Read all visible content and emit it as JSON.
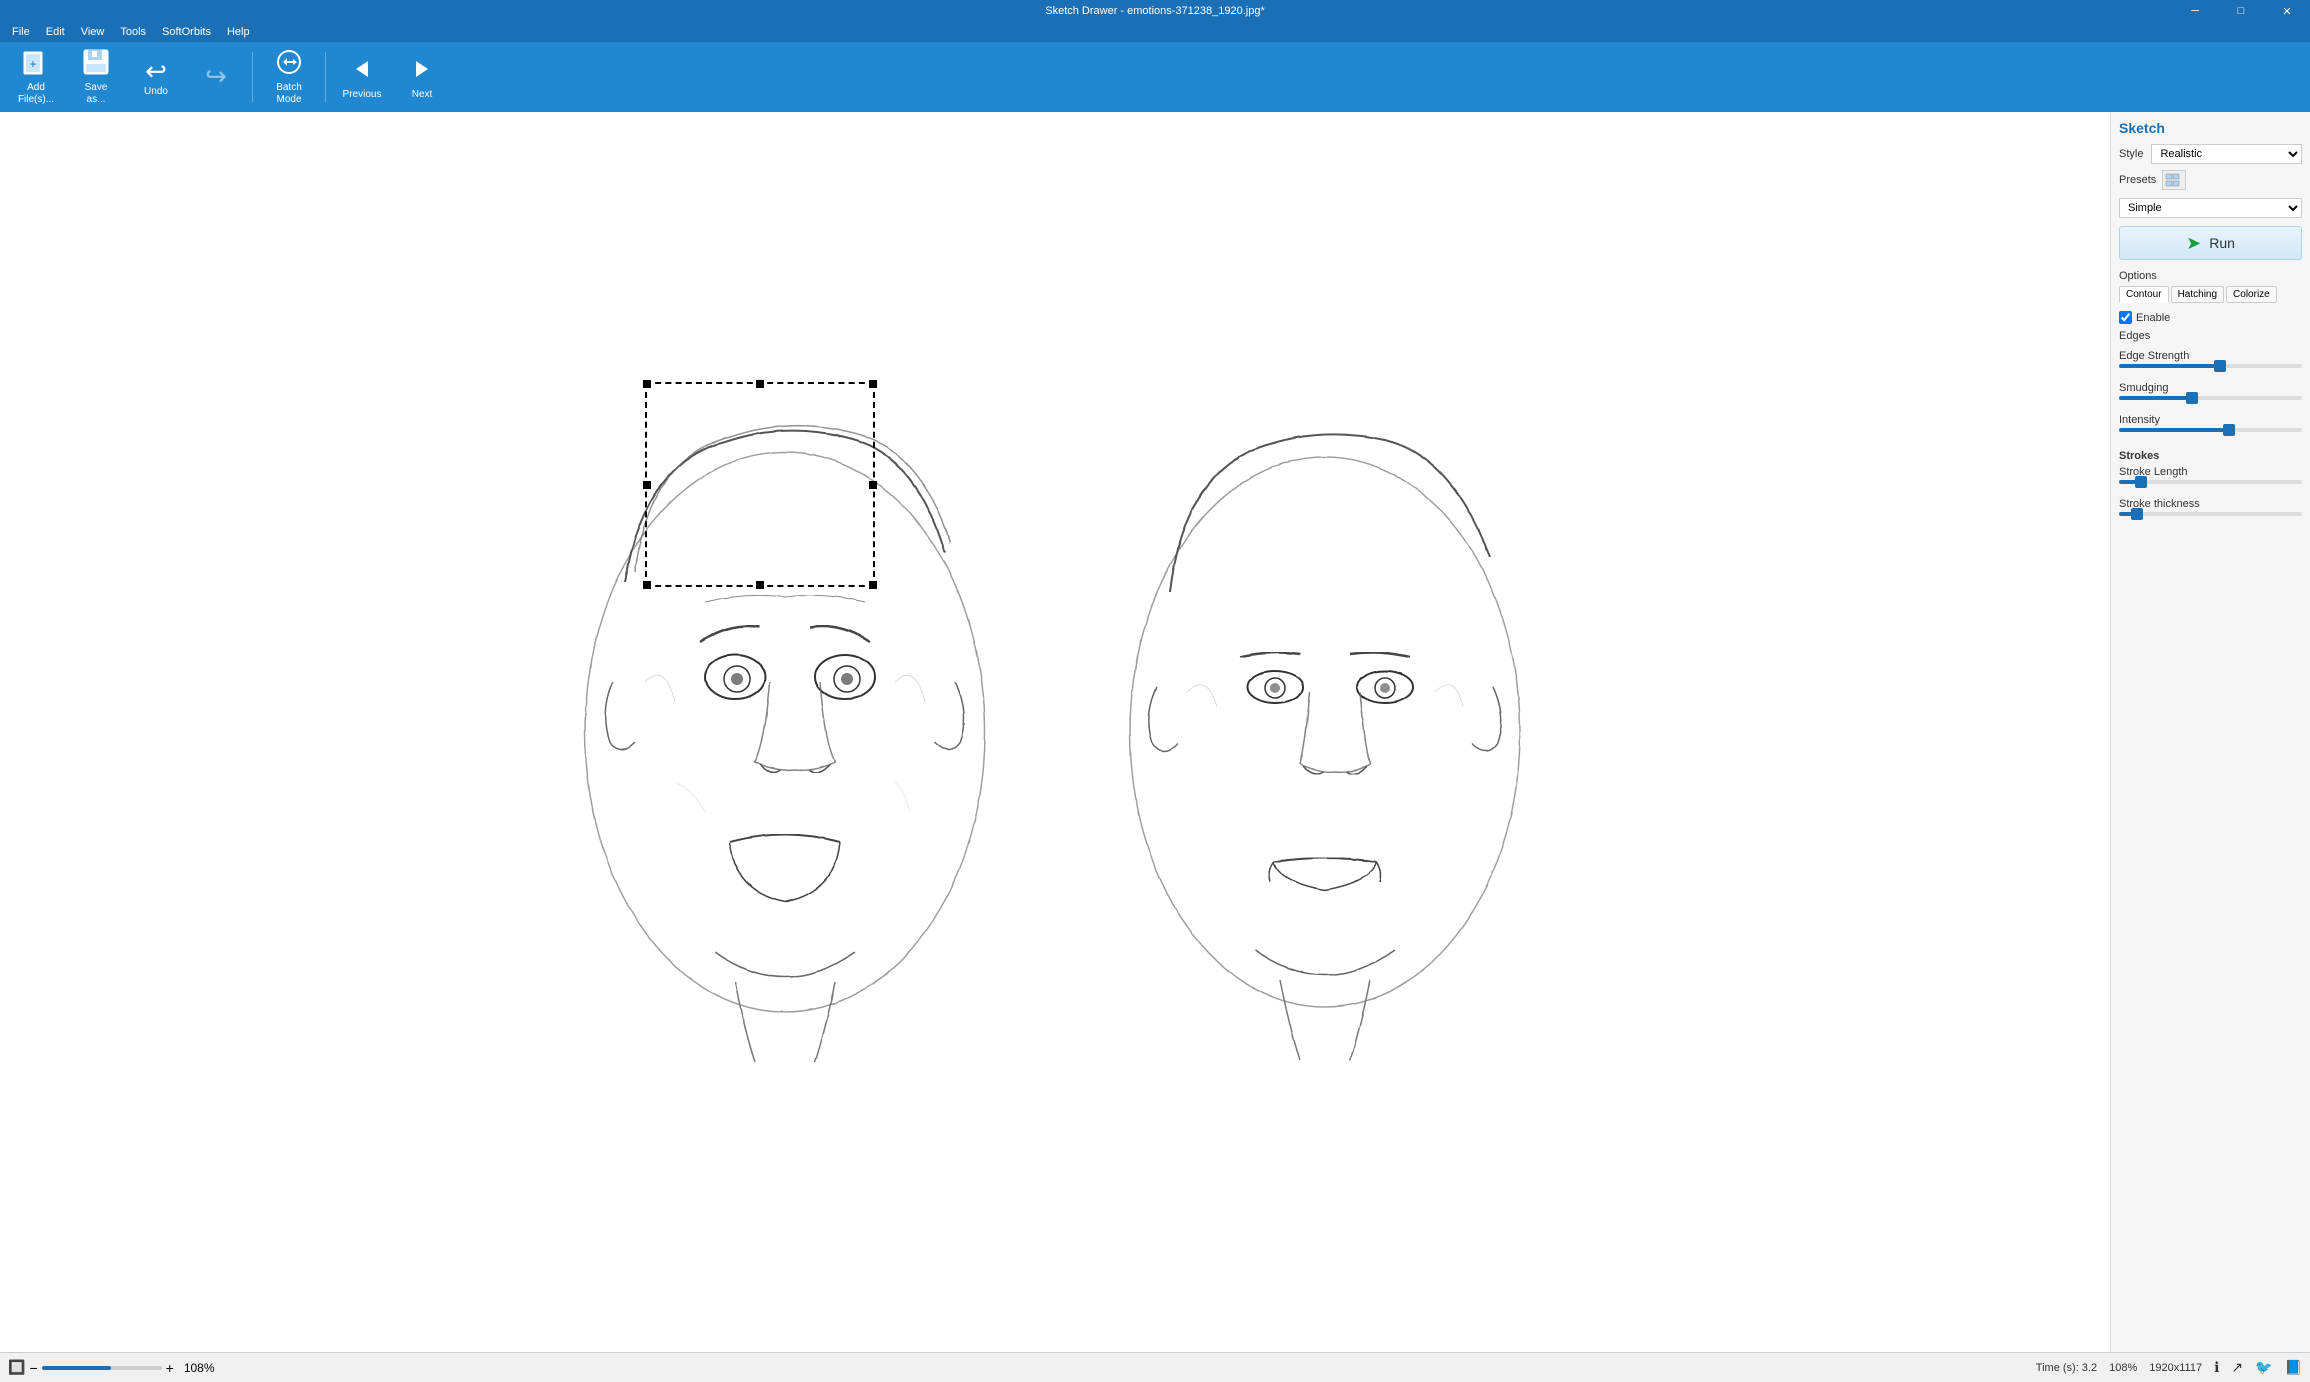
{
  "titleBar": {
    "title": "Sketch Drawer - emotions-371238_1920.jpg*",
    "minimize": "─",
    "maximize": "□",
    "close": "✕"
  },
  "menuBar": {
    "items": [
      "File",
      "Edit",
      "View",
      "Tools",
      "SoftOrbits",
      "Help"
    ]
  },
  "toolbar": {
    "buttons": [
      {
        "label": "Add\nFile(s)...",
        "icon": "📁",
        "name": "add-files"
      },
      {
        "label": "Save\nas...",
        "icon": "💾",
        "name": "save-as"
      },
      {
        "label": "Undo",
        "icon": "↩",
        "name": "undo"
      },
      {
        "label": "",
        "icon": "↪",
        "name": "redo"
      },
      {
        "label": "Batch\nMode",
        "icon": "⚙",
        "name": "batch-mode"
      },
      {
        "label": "Previous",
        "icon": "◀",
        "name": "previous"
      },
      {
        "label": "Next",
        "icon": "▶",
        "name": "next"
      }
    ]
  },
  "rightPanel": {
    "title": "Sketch",
    "styleLabel": "Style",
    "styleValue": "Realistic",
    "presetsLabel": "Presets",
    "presetsValue": "Simple",
    "runLabel": "Run",
    "optionsLabel": "Options",
    "tabs": [
      "Contour",
      "Hatching",
      "Colorize"
    ],
    "enableEdgesLabel": "Enable",
    "edgesLabel": "Edges",
    "edgeStrengthLabel": "Edge Strength",
    "edgeStrengthValue": 55,
    "smudgingLabel": "Smudging",
    "smudgingValue": 40,
    "intensityLabel": "Intensity",
    "intensityValue": 60,
    "strokesLabel": "Strokes",
    "strokeLengthLabel": "Stroke Length",
    "strokeLengthValue": 15,
    "strokeThicknessLabel": "Stroke thickness",
    "strokeThicknessValue": 12
  },
  "statusBar": {
    "timeLabel": "Time (s): 3.2",
    "zoomLabel": "108%",
    "resolutionLabel": "1920x1117",
    "zoomValue": 108
  }
}
